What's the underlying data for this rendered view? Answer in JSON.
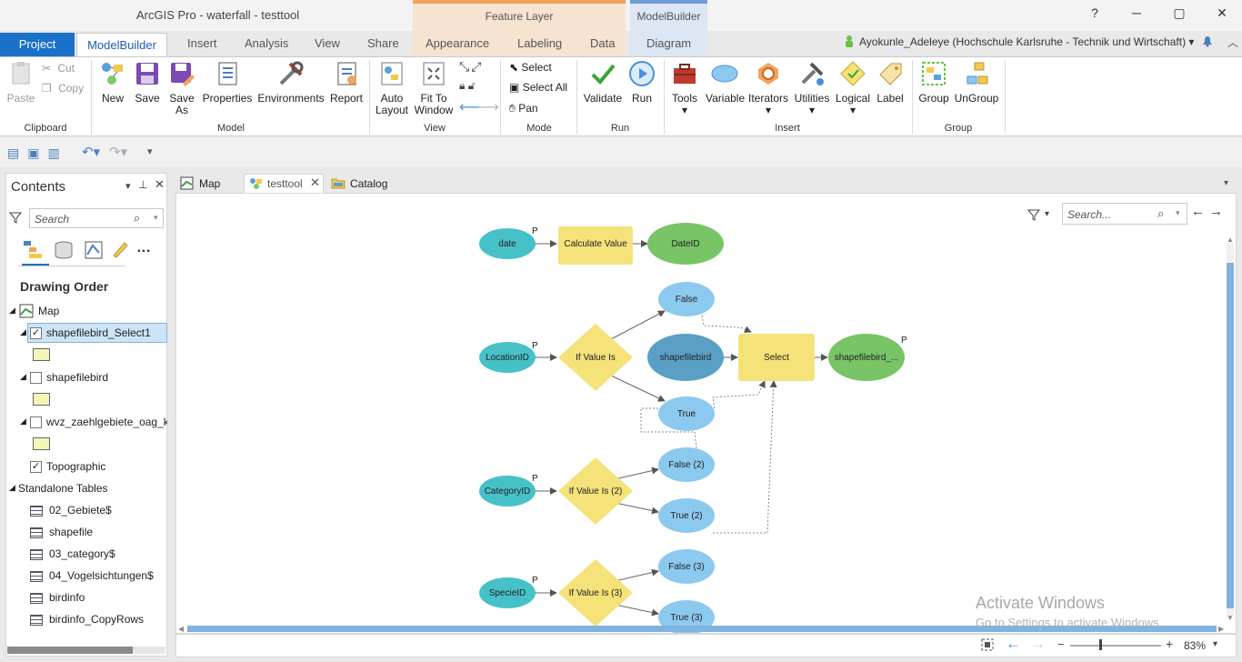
{
  "window": {
    "title": "ArcGIS Pro - waterfall - testtool",
    "help": "?",
    "minimize": "─",
    "maximize": "▢",
    "close": "✕"
  },
  "context_tabs": {
    "feature_layer": "Feature Layer",
    "modelbuilder": "ModelBuilder"
  },
  "tabs": {
    "project": "Project",
    "modelbuilder": "ModelBuilder",
    "insert": "Insert",
    "analysis": "Analysis",
    "view": "View",
    "share": "Share",
    "appearance": "Appearance",
    "labeling": "Labeling",
    "data": "Data",
    "diagram": "Diagram"
  },
  "user": "Ayokunle_Adeleye (Hochschule Karlsruhe - Technik und Wirtschaft) ▾",
  "ribbon": {
    "clipboard": {
      "paste": "Paste",
      "cut": "Cut",
      "copy": "Copy",
      "group": "Clipboard"
    },
    "model": {
      "new": "New",
      "save": "Save",
      "save_as_1": "Save",
      "save_as_2": "As",
      "properties": "Properties",
      "environments": "Environments",
      "report": "Report",
      "group": "Model"
    },
    "view": {
      "auto_layout_1": "Auto",
      "auto_layout_2": "Layout",
      "fit_1": "Fit To",
      "fit_2": "Window",
      "group": "View"
    },
    "mode": {
      "select": "Select",
      "select_all": "Select All",
      "pan": "Pan",
      "group": "Mode"
    },
    "run": {
      "validate": "Validate",
      "run": "Run",
      "group": "Run"
    },
    "insert": {
      "tools": "Tools",
      "variable": "Variable",
      "iterators": "Iterators",
      "utilities": "Utilities",
      "logical": "Logical",
      "label": "Label",
      "group": "Insert"
    },
    "group": {
      "group": "Group",
      "ungroup": "UnGroup",
      "title": "Group"
    }
  },
  "contents": {
    "title": "Contents",
    "search_placeholder": "Search",
    "drawing_order": "Drawing Order",
    "map": "Map",
    "layers": [
      {
        "name": "shapefilebird_Select1",
        "checked": true
      },
      {
        "name": "shapefilebird",
        "checked": false
      },
      {
        "name": "wvz_zaehlgebiete_oag_ka",
        "checked": false
      },
      {
        "name": "Topographic",
        "checked": true
      }
    ],
    "standalone": "Standalone Tables",
    "tables": [
      "02_Gebiete$",
      "shapefile",
      "03_category$",
      "04_Vogelsichtungen$",
      "birdinfo",
      "birdinfo_CopyRows"
    ]
  },
  "doc_tabs": {
    "map": "Map",
    "testtool": "testtool",
    "catalog": "Catalog"
  },
  "canvas": {
    "search_placeholder": "Search...",
    "watermark_1": "Activate Windows",
    "watermark_2": "Go to Settings to activate Windows."
  },
  "model": {
    "nodes": {
      "date": "date",
      "calc": "Calculate Value",
      "dateid": "DateID",
      "false1": "False",
      "locationid": "LocationID",
      "ifvalue": "If Value Is",
      "shapefilebird": "shapefilebird",
      "select": "Select",
      "output": "shapefilebird_...",
      "true1": "True",
      "false2": "False (2)",
      "categoryid": "CategoryID",
      "ifvalue2": "If Value Is (2)",
      "true2": "True (2)",
      "false3": "False (3)",
      "specieid": "SpecieID",
      "ifvalue3": "If Value Is (3)",
      "true3": "True (3)",
      "p": "P"
    }
  },
  "status": {
    "zoom": "83%"
  },
  "colors": {
    "accent": "#1a71c9",
    "variable_teal": "#47c1c8",
    "tool_yellow": "#f5e279",
    "output_green": "#78c466",
    "bool_blue": "#8cc9ef",
    "data_blue": "#5aa0c5"
  }
}
